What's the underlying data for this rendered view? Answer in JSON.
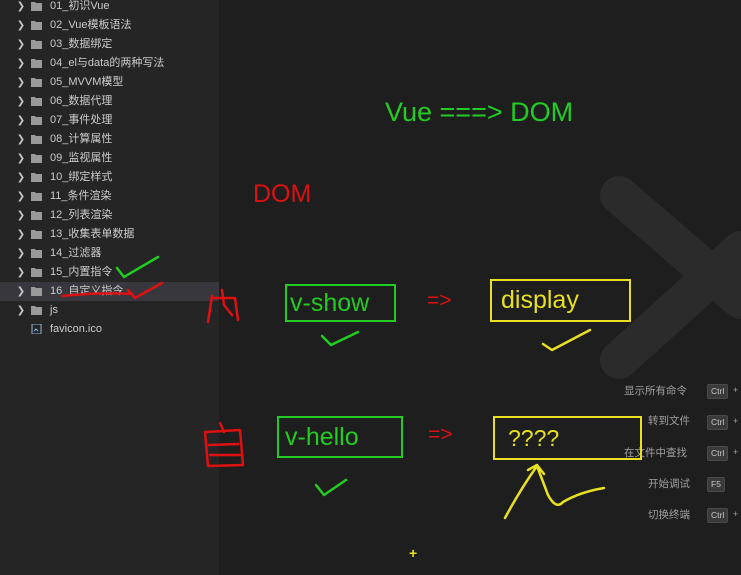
{
  "explorer": {
    "items": [
      {
        "label": "01_初识Vue",
        "type": "folder"
      },
      {
        "label": "02_Vue模板语法",
        "type": "folder"
      },
      {
        "label": "03_数据绑定",
        "type": "folder"
      },
      {
        "label": "04_el与data的两种写法",
        "type": "folder"
      },
      {
        "label": "05_MVVM模型",
        "type": "folder"
      },
      {
        "label": "06_数据代理",
        "type": "folder"
      },
      {
        "label": "07_事件处理",
        "type": "folder"
      },
      {
        "label": "08_计算属性",
        "type": "folder"
      },
      {
        "label": "09_监视属性",
        "type": "folder"
      },
      {
        "label": "10_绑定样式",
        "type": "folder"
      },
      {
        "label": "11_条件渲染",
        "type": "folder"
      },
      {
        "label": "12_列表渲染",
        "type": "folder"
      },
      {
        "label": "13_收集表单数据",
        "type": "folder"
      },
      {
        "label": "14_过滤器",
        "type": "folder"
      },
      {
        "label": "15_内置指令",
        "type": "folder"
      },
      {
        "label": "16_自定义指令",
        "type": "folder"
      },
      {
        "label": "js",
        "type": "folder"
      },
      {
        "label": "favicon.ico",
        "type": "file"
      }
    ]
  },
  "annotations": {
    "title": "Vue ===> DOM",
    "dom_label": "DOM",
    "vshow": "v-show",
    "display": "display",
    "vhello": "v-hello",
    "unknown": "????",
    "arrow1": "=>",
    "arrow2": "=>"
  },
  "shortcuts": [
    {
      "label": "显示所有命令",
      "key": "Ctrl"
    },
    {
      "label": "转到文件",
      "key": "Ctrl"
    },
    {
      "label": "在文件中查找",
      "key": "Ctrl"
    },
    {
      "label": "开始调试",
      "key": "F5"
    },
    {
      "label": "切换终端",
      "key": "Ctrl"
    }
  ],
  "colors": {
    "green": "#22cc22",
    "red": "#dd1111",
    "yellow": "#e8e020"
  }
}
